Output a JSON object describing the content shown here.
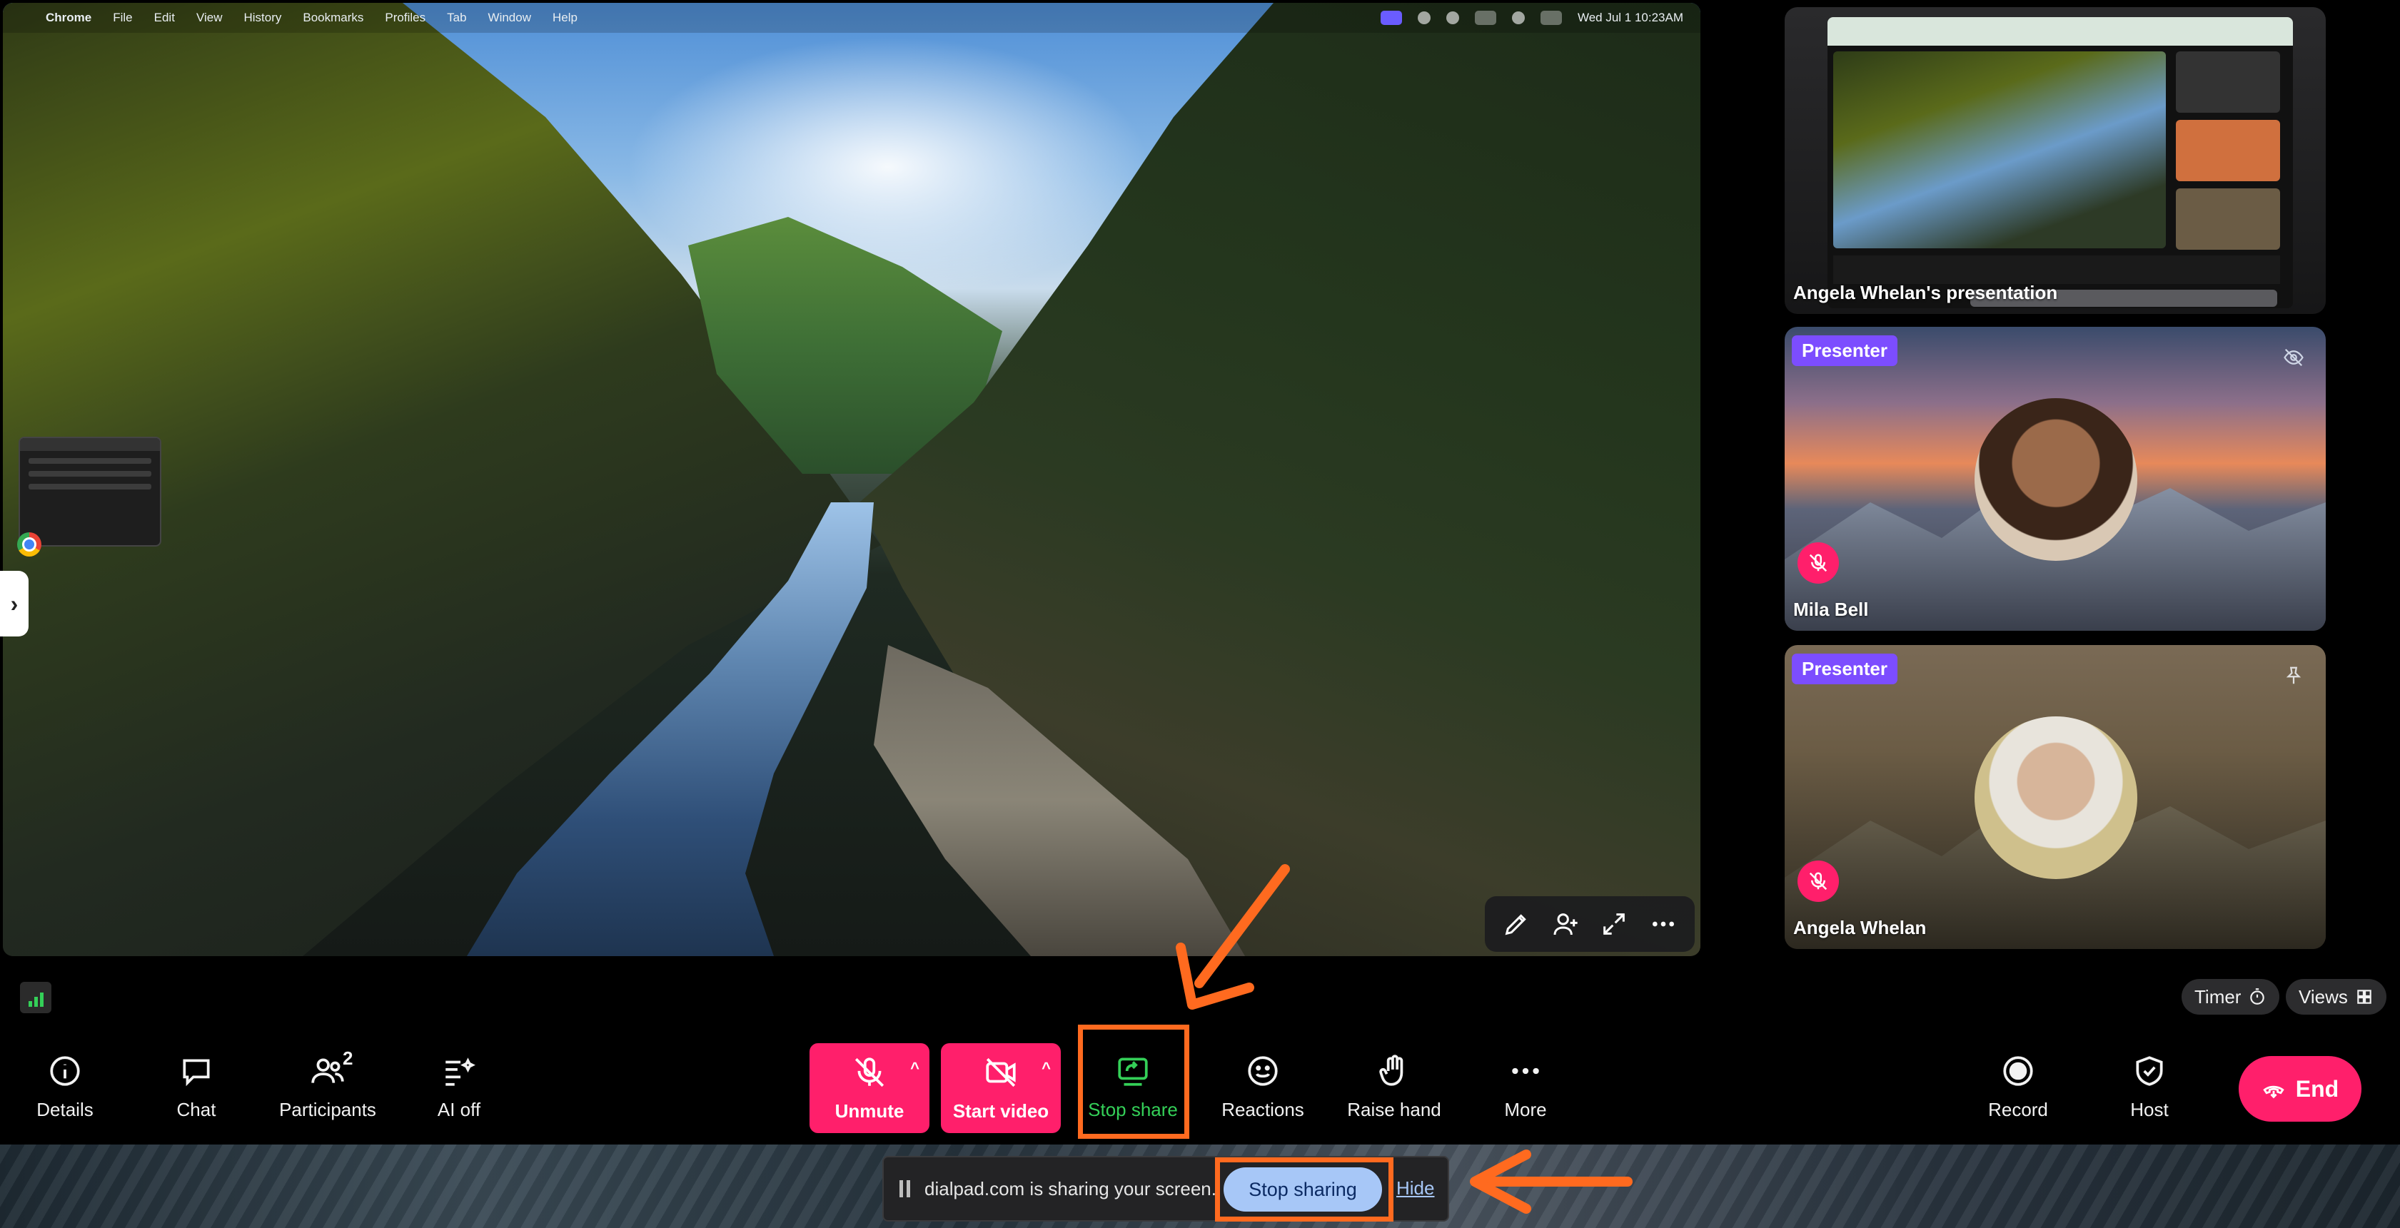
{
  "mac_menubar": {
    "app": "Chrome",
    "menus": [
      "File",
      "Edit",
      "View",
      "History",
      "Bookmarks",
      "Profiles",
      "Tab",
      "Window",
      "Help"
    ],
    "clock": "Wed Jul 1  10:23AM"
  },
  "tiles": {
    "presentation": {
      "name": "Angela Whelan's presentation"
    },
    "mila": {
      "badge": "Presenter",
      "name": "Mila Bell"
    },
    "angela": {
      "badge": "Presenter",
      "name": "Angela Whelan"
    }
  },
  "pills": {
    "timer": "Timer",
    "views": "Views"
  },
  "toolbar": {
    "details": "Details",
    "chat": "Chat",
    "participants": "Participants",
    "participants_count": "2",
    "ai": "AI off",
    "unmute": "Unmute",
    "start_video": "Start video",
    "stop_share": "Stop share",
    "reactions": "Reactions",
    "raise_hand": "Raise hand",
    "more": "More",
    "record": "Record",
    "host": "Host",
    "end": "End"
  },
  "share_bar": {
    "message": "dialpad.com is sharing your screen.",
    "stop": "Stop sharing",
    "hide": "Hide"
  },
  "colors": {
    "accent_red": "#ff1f6b",
    "stop_share_green": "#34d058",
    "presenter_purple": "#7c4dff",
    "annotation_orange": "#ff6a1f"
  },
  "icons": [
    "info-icon",
    "chat-icon",
    "participants-icon",
    "ai-icon",
    "mic-off-icon",
    "video-off-icon",
    "share-screen-icon",
    "smiley-icon",
    "hand-icon",
    "more-icon",
    "record-icon",
    "shield-icon",
    "phone-end-icon",
    "pencil-icon",
    "add-person-icon",
    "expand-icon",
    "eye-off-icon",
    "pin-icon",
    "timer-icon",
    "grid-icon",
    "signal-icon",
    "chevron-right-icon",
    "pause-icon"
  ]
}
